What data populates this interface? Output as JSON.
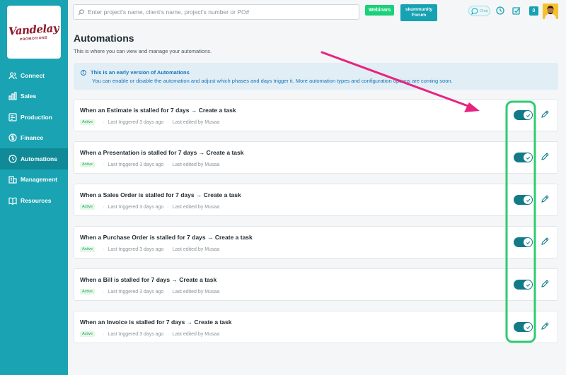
{
  "brand": {
    "logo_text": "Vandelay",
    "logo_subtext": "PROMOTIONS"
  },
  "sidebar": {
    "items": [
      {
        "label": "Connect",
        "icon": "users-icon"
      },
      {
        "label": "Sales",
        "icon": "bar-chart-icon"
      },
      {
        "label": "Production",
        "icon": "board-icon"
      },
      {
        "label": "Finance",
        "icon": "dollar-icon"
      },
      {
        "label": "Automations",
        "icon": "automation-icon",
        "active": true
      },
      {
        "label": "Management",
        "icon": "building-icon"
      },
      {
        "label": "Resources",
        "icon": "book-icon"
      }
    ]
  },
  "header": {
    "search_placeholder": "Enter project's name, client's name, project's number or PO#",
    "webinars_label": "Webinars",
    "forum_line1": "skummunity",
    "forum_line2": "Forum",
    "chat_label": "Chat",
    "notification_count": "0"
  },
  "main": {
    "title": "Automations",
    "subtitle": "This is where you can view and manage your automations.",
    "info_title": "This is an early version of Automations",
    "info_text": "You can enable or disable the automation and adjust which phases and days trigger it. More automation types and configuration options are coming soon."
  },
  "automations": [
    {
      "title": "When an Estimate is stalled for 7 days → Create a task",
      "status": "Active",
      "last_triggered": "Last triggered 3 days ago",
      "last_edited": "Last edited by Musaa",
      "enabled": true
    },
    {
      "title": "When a Presentation is stalled for 7 days → Create a task",
      "status": "Active",
      "last_triggered": "Last triggered 3 days ago",
      "last_edited": "Last edited by Musaa",
      "enabled": true
    },
    {
      "title": "When a Sales Order is stalled for 7 days → Create a task",
      "status": "Active",
      "last_triggered": "Last triggered 3 days ago",
      "last_edited": "Last edited by Musaa",
      "enabled": true
    },
    {
      "title": "When a Purchase Order is stalled for 7 days → Create a task",
      "status": "Active",
      "last_triggered": "Last triggered 3 days ago",
      "last_edited": "Last edited by Musaa",
      "enabled": true
    },
    {
      "title": "When a Bill is stalled for 7 days → Create a task",
      "status": "Active",
      "last_triggered": "Last triggered 3 days ago",
      "last_edited": "Last edited by Musaa",
      "enabled": true
    },
    {
      "title": "When an Invoice is stalled for 7 days → Create a task",
      "status": "Active",
      "last_triggered": "Last triggered 3 days ago",
      "last_edited": "Last edited by Musaa",
      "enabled": true
    }
  ],
  "colors": {
    "sidebar": "#1aa3b3",
    "sidebar_active": "#118a98",
    "toggle_on": "#137a88",
    "annotation_arrow": "#e8237e",
    "annotation_highlight": "#2ecc71"
  }
}
